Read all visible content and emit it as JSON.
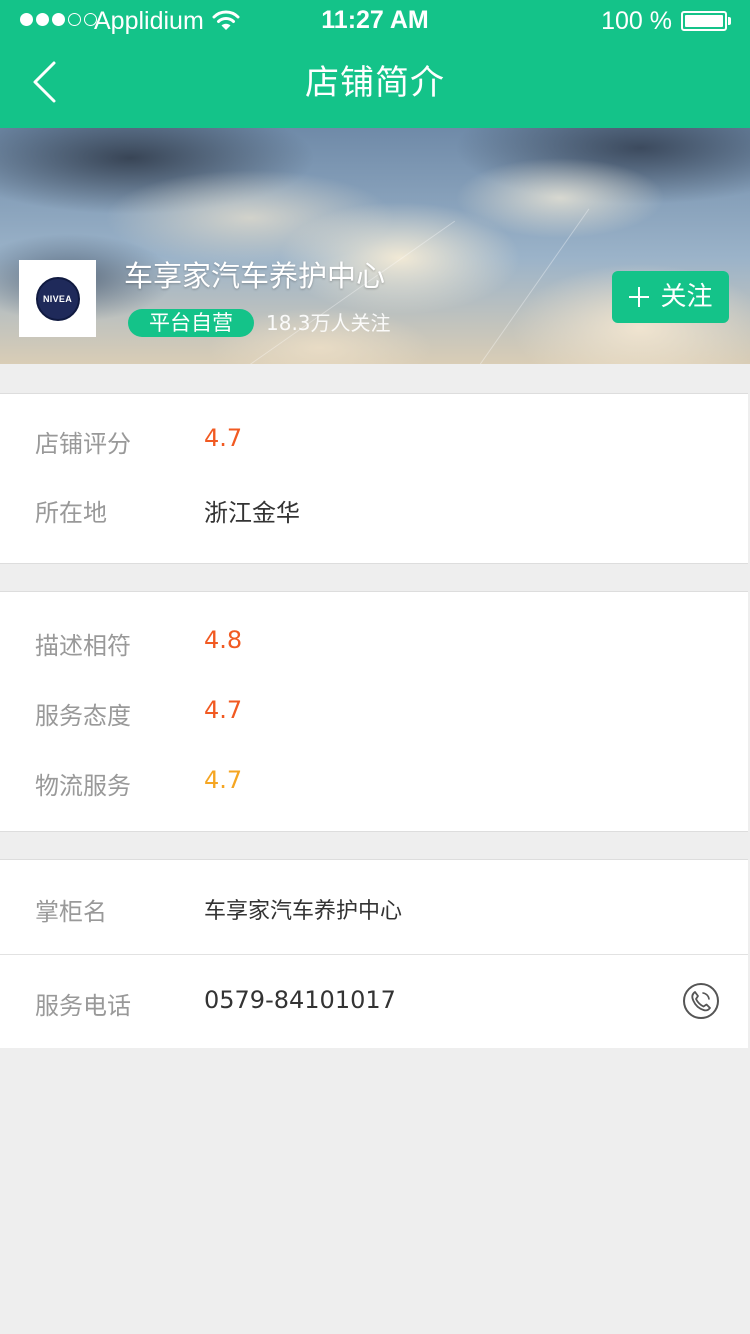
{
  "status_bar": {
    "carrier": "Applidium",
    "time": "11:27 AM",
    "battery": "100 %",
    "battery_level": 1.0,
    "signal_bars_filled": 3,
    "signal_bars_total": 5,
    "icons": [
      "signal-dots-icon",
      "wifi-icon",
      "battery-icon"
    ]
  },
  "nav": {
    "title": "店铺简介",
    "back_icon": "chevron-left-icon"
  },
  "store": {
    "name": "车享家汽车养护中心",
    "badge": "平台自营",
    "followers": "18.3万人关注",
    "logo_text": "NIVEA",
    "follow_label": "关注",
    "follow_icon": "plus-icon"
  },
  "rating_card": {
    "rows": [
      {
        "label": "店铺评分",
        "value": "4.7",
        "color": "#f15a22"
      },
      {
        "label": "所在地",
        "value": "浙江金华",
        "color": "#333333"
      }
    ]
  },
  "detail_card": {
    "rows": [
      {
        "label": "描述相符",
        "value": "4.8",
        "color": "#f15a22"
      },
      {
        "label": "服务态度",
        "value": "4.7",
        "color": "#f15a22"
      },
      {
        "label": "物流服务",
        "value": "4.7",
        "color": "#f5a623"
      }
    ]
  },
  "contact_card": {
    "rows": [
      {
        "label": "掌柜名",
        "value": "车享家汽车养护中心"
      },
      {
        "label": "服务电话",
        "value": "0579-84101017",
        "icon": "phone-icon"
      }
    ]
  },
  "colors": {
    "brand_green": "#14c389",
    "rating_orange": "#f15a22",
    "rating_amber": "#f5a623",
    "page_background": "#eeeeee"
  }
}
